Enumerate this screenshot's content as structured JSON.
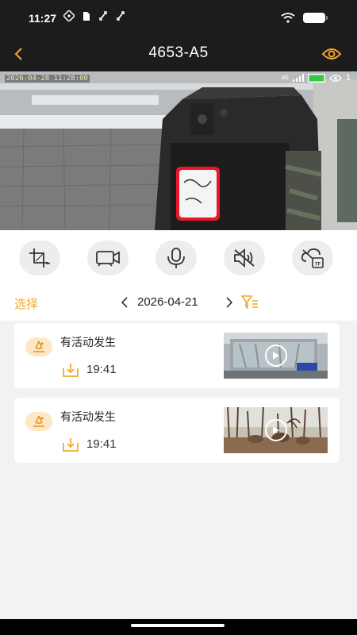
{
  "status_bar": {
    "time": "11:27"
  },
  "nav": {
    "title": "4653-A5"
  },
  "video": {
    "timestamp": "2026-04-28 11:28:00",
    "signal": "4G",
    "viewer_count": "1",
    "battery_level": 1.0,
    "battery_color": "#2ecc40"
  },
  "controls": {
    "items": [
      {
        "icon": "crop-icon"
      },
      {
        "icon": "video-record-icon"
      },
      {
        "icon": "microphone-icon"
      },
      {
        "icon": "speaker-mute-icon"
      },
      {
        "icon": "cloud-tf-icon"
      }
    ]
  },
  "date_bar": {
    "select_label": "选择",
    "date": "2026-04-21"
  },
  "events": [
    {
      "title": "有活动发生",
      "time": "19:41",
      "thumbnail": "indoor-water-tank"
    },
    {
      "title": "有活动发生",
      "time": "19:41",
      "thumbnail": "outdoor-forest-deer"
    }
  ],
  "colors": {
    "accent": "#f0a92d",
    "header_bg": "#1c1c1c",
    "list_bg": "#f2f2f2"
  }
}
